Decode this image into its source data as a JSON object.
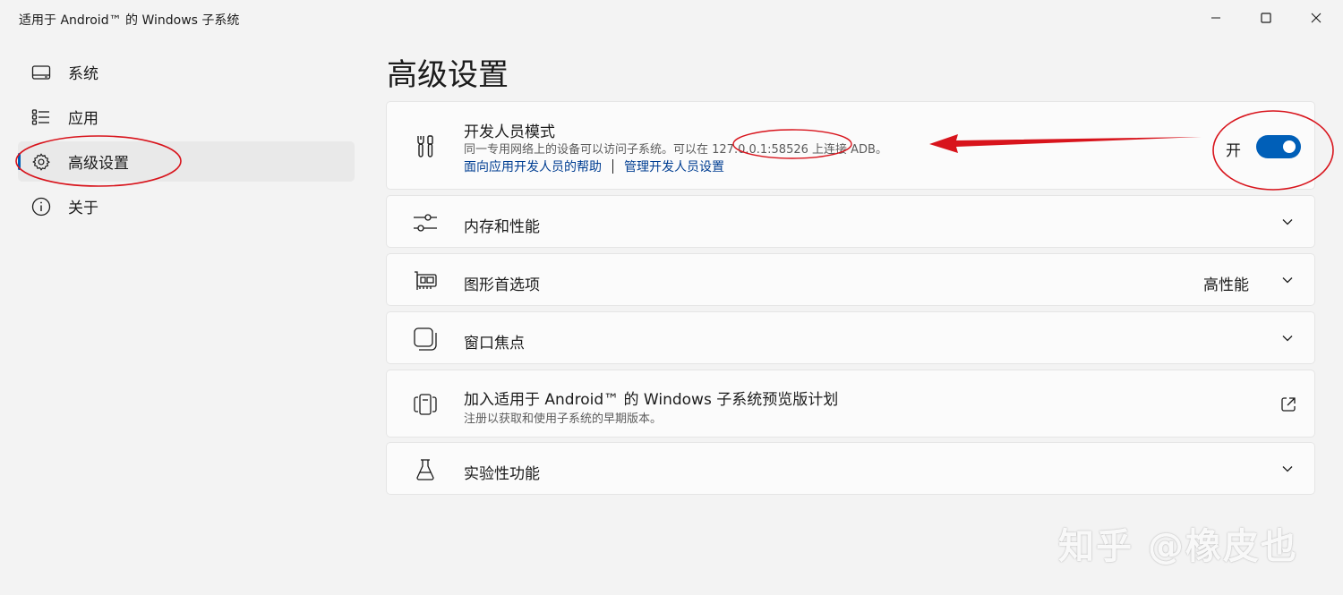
{
  "window": {
    "title": "适用于 Android™ 的 Windows 子系统"
  },
  "sidebar": {
    "items": [
      {
        "label": "系统",
        "icon": "monitor-icon"
      },
      {
        "label": "应用",
        "icon": "list-icon"
      },
      {
        "label": "高级设置",
        "icon": "gear-icon",
        "selected": true
      },
      {
        "label": "关于",
        "icon": "info-icon"
      }
    ]
  },
  "main": {
    "title": "高级设置",
    "developer": {
      "title": "开发人员模式",
      "desc": "同一专用网络上的设备可以访问子系统。可以在 127.0.0.1:58526 上连接 ADB。",
      "link_help": "面向应用开发人员的帮助",
      "link_manage": "管理开发人员设置",
      "toggle_label": "开",
      "toggle_on": true
    },
    "memory": {
      "title": "内存和性能"
    },
    "graphics": {
      "title": "图形首选项",
      "value": "高性能"
    },
    "focus": {
      "title": "窗口焦点"
    },
    "preview": {
      "title": "加入适用于 Android™ 的 Windows 子系统预览版计划",
      "desc": "注册以获取和使用子系统的早期版本。"
    },
    "experimental": {
      "title": "实验性功能"
    }
  },
  "watermark": "知乎 @橡皮也",
  "colors": {
    "accent": "#005fb8",
    "annotation": "#d8141c",
    "link": "#003e92"
  }
}
